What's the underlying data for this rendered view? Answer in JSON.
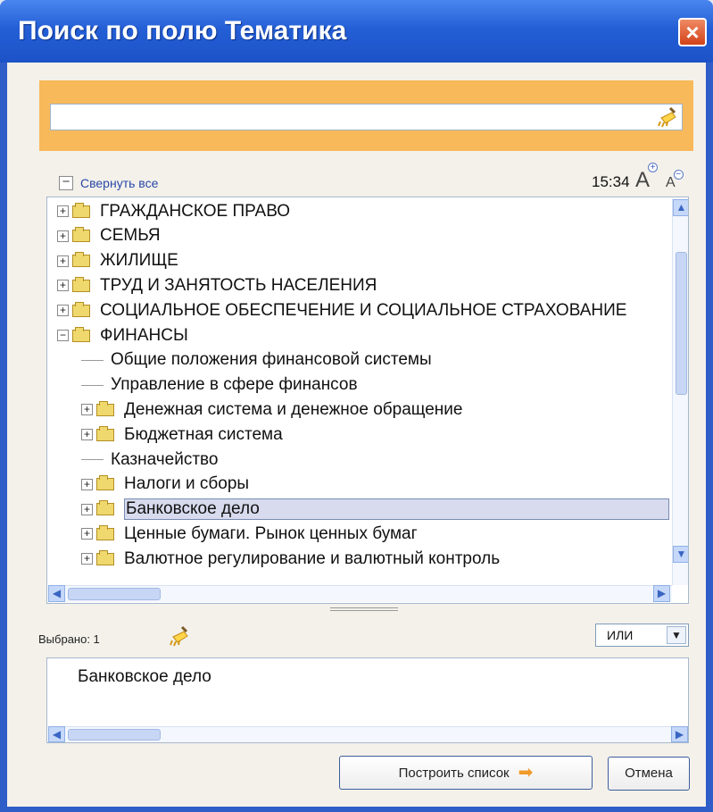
{
  "window": {
    "title": "Поиск по полю Тематика",
    "close_glyph": "×"
  },
  "search": {
    "value": "",
    "placeholder": "",
    "clear_icon": "broom-icon"
  },
  "toolbar": {
    "collapse_all": "Свернуть все",
    "time": "15:34",
    "font_increase_icon": "font-increase-icon",
    "font_decrease_icon": "font-decrease-icon"
  },
  "tree": {
    "items": [
      {
        "label": "ГРАЖДАНСКОЕ ПРАВО",
        "level": 0,
        "type": "folder",
        "expanded": false
      },
      {
        "label": "СЕМЬЯ",
        "level": 0,
        "type": "folder",
        "expanded": false
      },
      {
        "label": "ЖИЛИЩЕ",
        "level": 0,
        "type": "folder",
        "expanded": false
      },
      {
        "label": "ТРУД И ЗАНЯТОСТЬ НАСЕЛЕНИЯ",
        "level": 0,
        "type": "folder",
        "expanded": false
      },
      {
        "label": "СОЦИАЛЬНОЕ ОБЕСПЕЧЕНИЕ И СОЦИАЛЬНОЕ СТРАХОВАНИЕ",
        "level": 0,
        "type": "folder",
        "expanded": false
      },
      {
        "label": "ФИНАНСЫ",
        "level": 0,
        "type": "folder",
        "expanded": true
      },
      {
        "label": "Общие положения финансовой системы",
        "level": 1,
        "type": "leaf"
      },
      {
        "label": "Управление в сфере финансов",
        "level": 1,
        "type": "leaf"
      },
      {
        "label": "Денежная система и денежное обращение",
        "level": 1,
        "type": "folder",
        "expanded": false
      },
      {
        "label": "Бюджетная система",
        "level": 1,
        "type": "folder",
        "expanded": false
      },
      {
        "label": "Казначейство",
        "level": 1,
        "type": "leaf"
      },
      {
        "label": "Налоги и сборы",
        "level": 1,
        "type": "folder",
        "expanded": false
      },
      {
        "label": "Банковское дело",
        "level": 1,
        "type": "folder",
        "expanded": false,
        "selected": true
      },
      {
        "label": "Ценные бумаги. Рынок ценных бумаг",
        "level": 1,
        "type": "folder",
        "expanded": false
      },
      {
        "label": "Валютное регулирование и валютный контроль",
        "level": 1,
        "type": "folder",
        "expanded": false
      }
    ]
  },
  "selection": {
    "label": "Выбрано: 1",
    "logic_operator": "ИЛИ",
    "items": [
      "Банковское дело"
    ]
  },
  "buttons": {
    "build_list": "Построить список",
    "cancel": "Отмена"
  },
  "icons": {
    "folder": "folder-icon",
    "expand": "plus-icon",
    "collapse": "minus-icon",
    "scroll_up": "scroll-up-icon",
    "scroll_down": "scroll-down-icon",
    "scroll_left": "scroll-left-icon",
    "scroll_right": "scroll-right-icon",
    "build_arrow": "arrow-right-icon"
  },
  "colors": {
    "title_bar": "#245fd6",
    "search_panel": "#f8b95a",
    "selected_row": "#d7dbed",
    "dialog_bg": "#f3f1ea"
  }
}
